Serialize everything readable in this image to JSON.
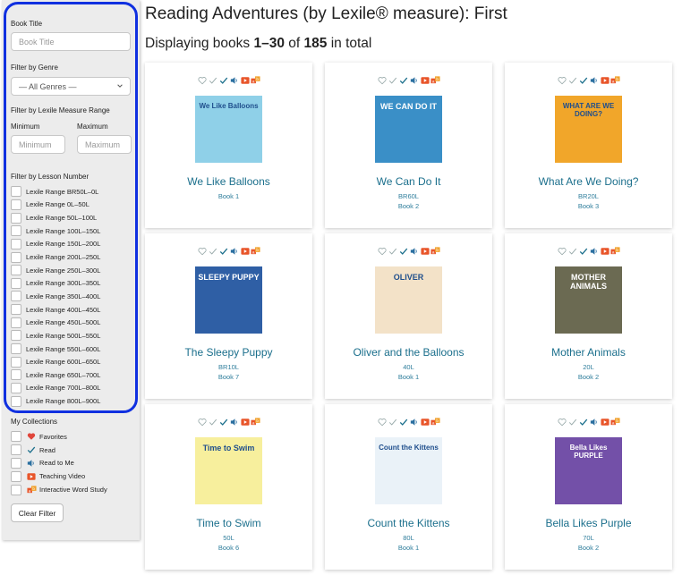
{
  "sidebar": {
    "book_title_label": "Book Title",
    "book_title_placeholder": "Book Title",
    "genre_label": "Filter by Genre",
    "genre_value": "— All Genres —",
    "lexile_label": "Filter by Lexile Measure Range",
    "min_label": "Minimum",
    "max_label": "Maximum",
    "min_placeholder": "Minimum",
    "max_placeholder": "Maximum",
    "lesson_label": "Filter by Lesson Number",
    "ranges": [
      "Lexile Range BR50L–0L",
      "Lexile Range 0L–50L",
      "Lexile Range 50L–100L",
      "Lexile Range 100L–150L",
      "Lexile Range 150L–200L",
      "Lexile Range 200L–250L",
      "Lexile Range 250L–300L",
      "Lexile Range 300L–350L",
      "Lexile Range 350L–400L",
      "Lexile Range 400L–450L",
      "Lexile Range 450L–500L",
      "Lexile Range 500L–550L",
      "Lexile Range 550L–600L",
      "Lexile Range 600L–650L",
      "Lexile Range 650L–700L",
      "Lexile Range 700L–800L",
      "Lexile Range 800L–900L"
    ],
    "collections_label": "My Collections",
    "collections": [
      {
        "label": "Favorites",
        "icon": "heart-icon"
      },
      {
        "label": "Read",
        "icon": "checkmark-icon"
      },
      {
        "label": "Read to Me",
        "icon": "speaker-icon"
      },
      {
        "label": "Teaching Video",
        "icon": "video-play-icon"
      },
      {
        "label": "Interactive Word Study",
        "icon": "word-study-icon"
      }
    ],
    "clear_label": "Clear Filter"
  },
  "main": {
    "title": "Reading Adventures (by Lexile® measure): First",
    "count_prefix": "Displaying books ",
    "count_range": "1–30",
    "count_of": " of ",
    "count_total": "185",
    "count_suffix": " in total"
  },
  "books": [
    {
      "title": "We Like Balloons",
      "lexile": "",
      "book": "Book 1",
      "cover_text": "We Like Balloons",
      "cover_bg": "#8fd0e8"
    },
    {
      "title": "We Can Do It",
      "lexile": "BR60L",
      "book": "Book 2",
      "cover_text": "WE CAN DO IT",
      "cover_bg": "#3a8fc7"
    },
    {
      "title": "What Are We Doing?",
      "lexile": "BR20L",
      "book": "Book 3",
      "cover_text": "WHAT ARE WE DOING?",
      "cover_bg": "#f1a62a"
    },
    {
      "title": "The Sleepy Puppy",
      "lexile": "BR10L",
      "book": "Book 7",
      "cover_text": "SLEEPY PUPPY",
      "cover_bg": "#2f5fa5"
    },
    {
      "title": "Oliver and the Balloons",
      "lexile": "40L",
      "book": "Book 1",
      "cover_text": "OLIVER",
      "cover_bg": "#f3e2c8"
    },
    {
      "title": "Mother Animals",
      "lexile": "20L",
      "book": "Book 2",
      "cover_text": "MOTHER ANIMALS",
      "cover_bg": "#6b6a52"
    },
    {
      "title": "Time to Swim",
      "lexile": "50L",
      "book": "Book 6",
      "cover_text": "Time to Swim",
      "cover_bg": "#f7ef9d"
    },
    {
      "title": "Count the Kittens",
      "lexile": "80L",
      "book": "Book 1",
      "cover_text": "Count the Kittens",
      "cover_bg": "#eaf2f8"
    },
    {
      "title": "Bella Likes Purple",
      "lexile": "70L",
      "book": "Book 2",
      "cover_text": "Bella Likes PURPLE",
      "cover_bg": "#7350a8"
    }
  ],
  "colors": {
    "highlight": "#1030e0",
    "link": "#1b6f8c",
    "heart": "#e0453a",
    "check": "#1b6f8c",
    "video": "#e8552a"
  }
}
